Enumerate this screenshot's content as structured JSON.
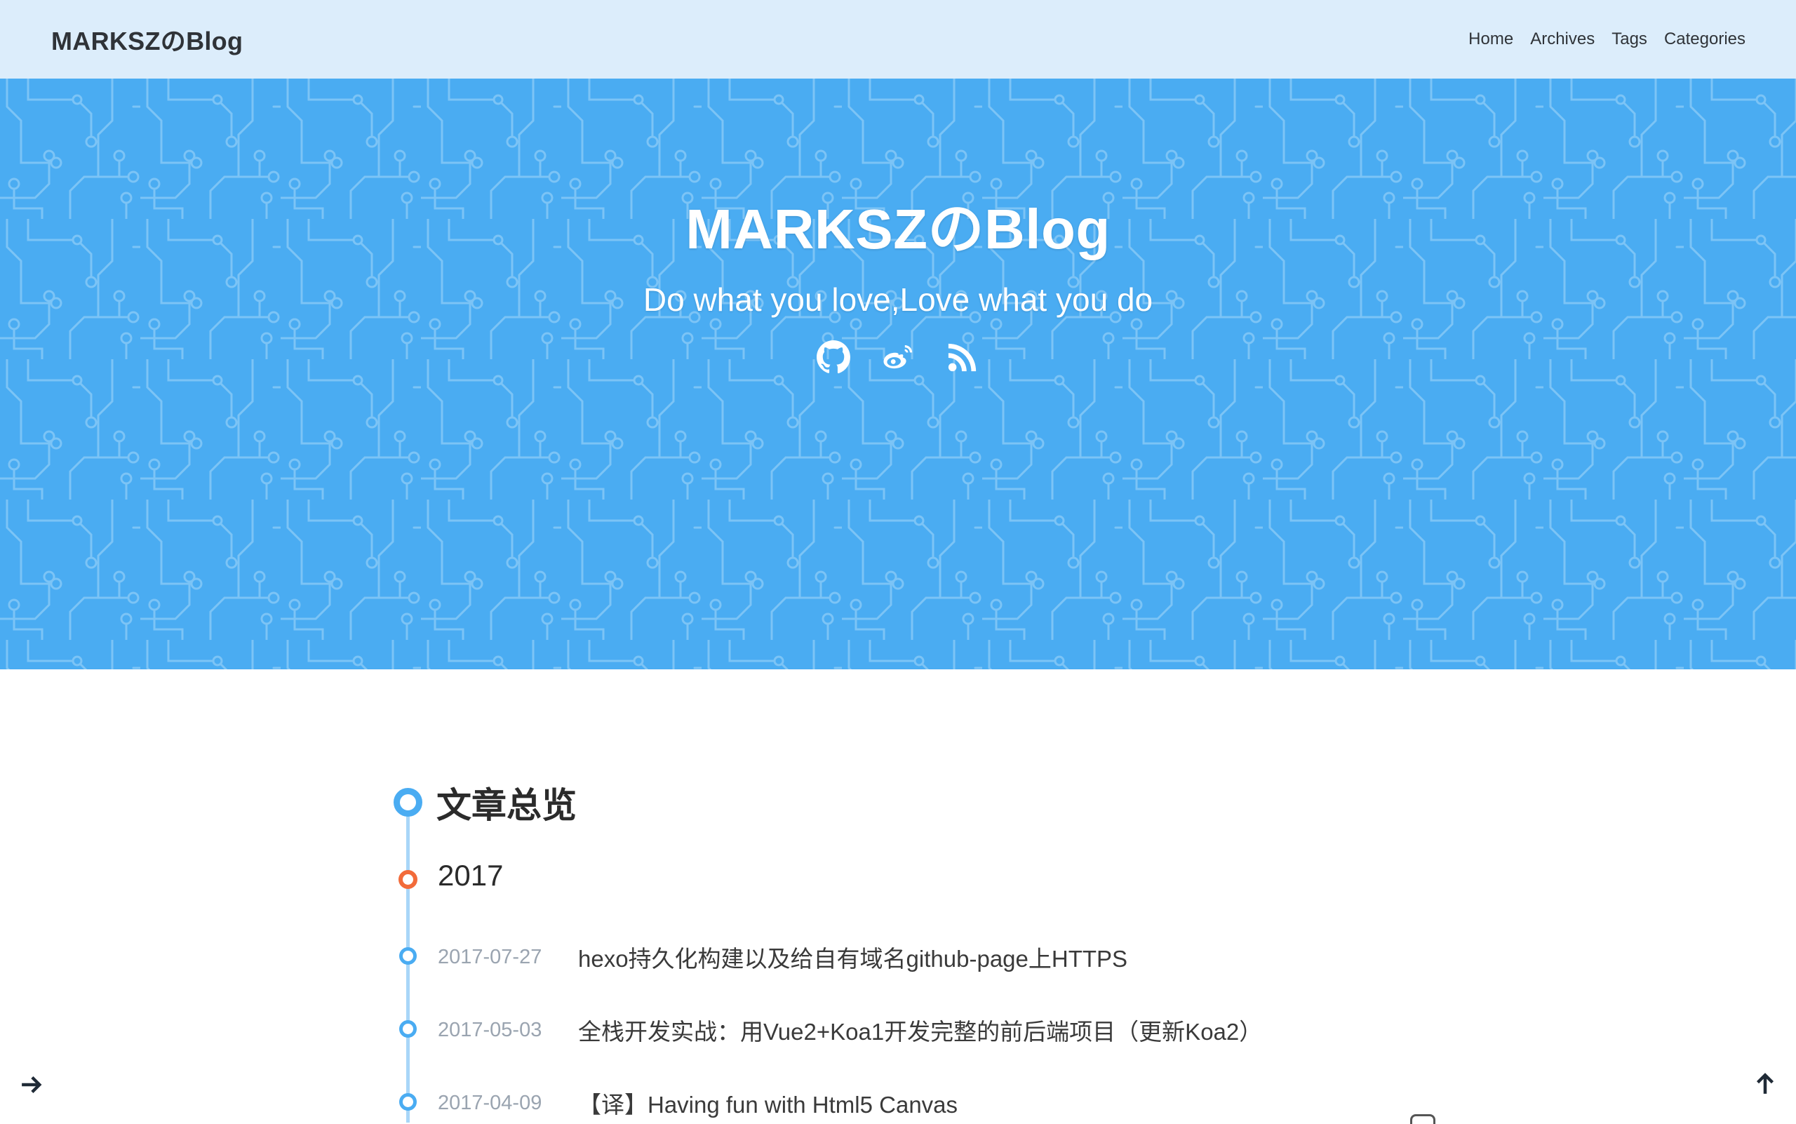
{
  "nav": {
    "brand": "MARKSZのBlog",
    "links": [
      {
        "label": "Home"
      },
      {
        "label": "Archives"
      },
      {
        "label": "Tags"
      },
      {
        "label": "Categories"
      }
    ]
  },
  "hero": {
    "title": "MARKSZのBlog",
    "subtitle": "Do what you love,Love what you do",
    "background_color": "#4aacf2",
    "icons": [
      "github-icon",
      "weibo-icon",
      "rss-icon"
    ]
  },
  "archive": {
    "heading": "文章总览",
    "year": "2017",
    "posts": [
      {
        "date": "2017-07-27",
        "title": "hexo持久化构建以及给自有域名github-page上HTTPS"
      },
      {
        "date": "2017-05-03",
        "title": "全栈开发实战：用Vue2+Koa1开发完整的前后端项目（更新Koa2）"
      },
      {
        "date": "2017-04-09",
        "title": "【译】Having fun with Html5 Canvas"
      }
    ]
  },
  "colors": {
    "navbar_bg": "#dcedfb",
    "accent": "#4aacf2",
    "year_node": "#f26b3a",
    "date_text": "#9aa4b0"
  },
  "floating": {
    "left_icon": "arrow-right-icon",
    "right_icon": "arrow-up-icon"
  }
}
